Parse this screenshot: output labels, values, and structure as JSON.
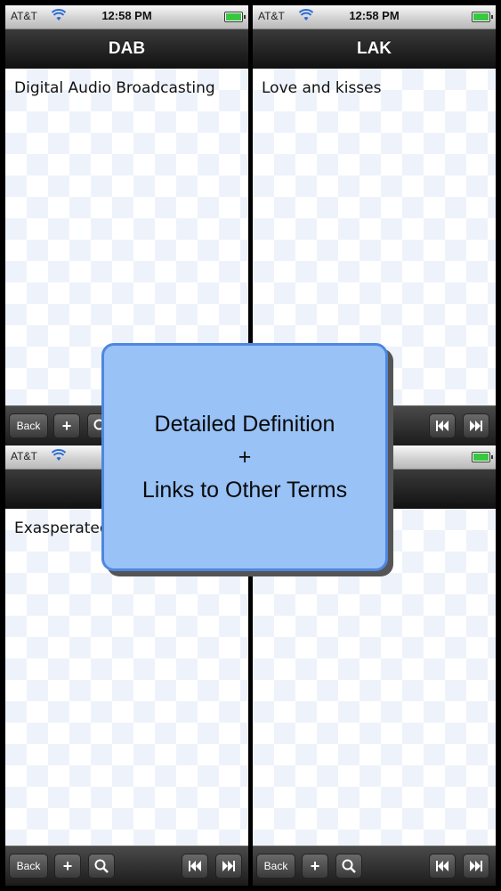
{
  "status": {
    "carrier": "AT&T",
    "time": "12:58 PM"
  },
  "phones": [
    {
      "title": "DAB",
      "definition": "Digital Audio Broadcasting"
    },
    {
      "title": "LAK",
      "definition": "Love and kisses"
    },
    {
      "title": "",
      "definition": "Exasperated,"
    },
    {
      "title": "",
      "definition": ""
    }
  ],
  "toolbar": {
    "back_label": "Back",
    "add_label": "+"
  },
  "overlay": {
    "line1": "Detailed Definition",
    "line2": "+",
    "line3": "Links to Other Terms"
  },
  "colors": {
    "overlay_bg": "#99c2f6",
    "overlay_border": "#4f86e0",
    "battery": "#36c940"
  }
}
